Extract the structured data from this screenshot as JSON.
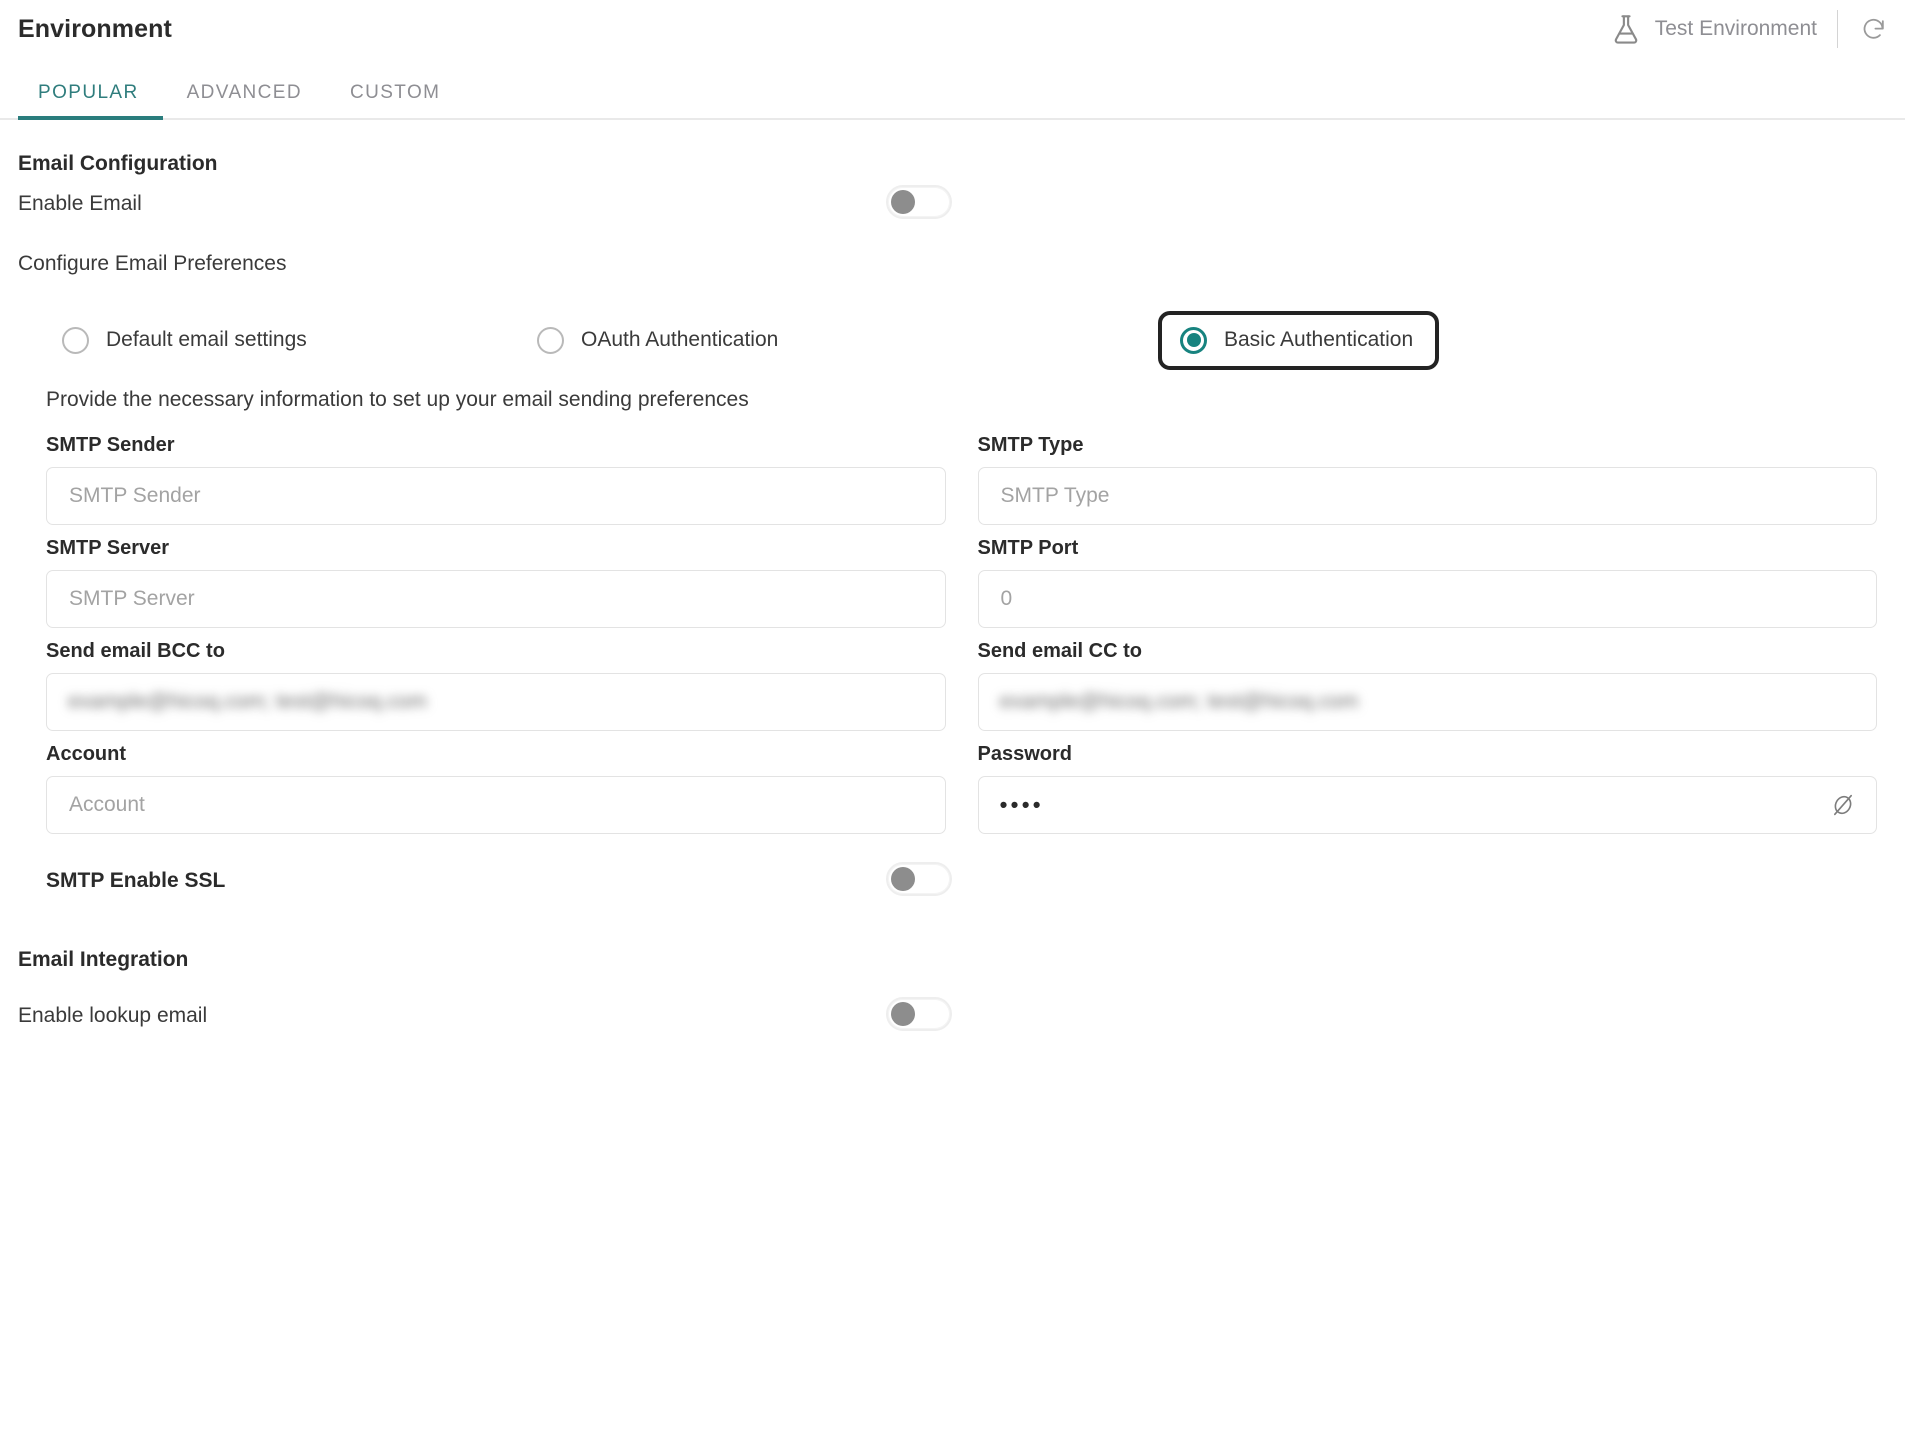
{
  "header": {
    "title": "Environment",
    "environment_label": "Test Environment",
    "flask_icon": "flask-icon",
    "refresh_icon": "refresh-icon"
  },
  "tabs": [
    {
      "label": "POPULAR",
      "active": true
    },
    {
      "label": "ADVANCED",
      "active": false
    },
    {
      "label": "CUSTOM",
      "active": false
    }
  ],
  "email_configuration": {
    "section_title": "Email Configuration",
    "enable_email": {
      "label": "Enable Email",
      "value": "off"
    },
    "configure_preferences_label": "Configure Email Preferences",
    "radio_options": [
      {
        "label": "Default email settings",
        "selected": false,
        "focused": false
      },
      {
        "label": "OAuth Authentication",
        "selected": false,
        "focused": false
      },
      {
        "label": "Basic Authentication",
        "selected": true,
        "focused": true
      }
    ],
    "helper_text": "Provide the necessary information to set up your email sending preferences",
    "fields": {
      "smtp_sender": {
        "label": "SMTP Sender",
        "value": "",
        "placeholder": "SMTP Sender"
      },
      "smtp_type": {
        "label": "SMTP Type",
        "value": "",
        "placeholder": "SMTP Type"
      },
      "smtp_server": {
        "label": "SMTP Server",
        "value": "",
        "placeholder": "SMTP Server"
      },
      "smtp_port": {
        "label": "SMTP Port",
        "value": "",
        "placeholder": "0"
      },
      "send_email_bcc_to": {
        "label": "Send email BCC to",
        "value": "example@hicoq.com; test@hicoq.com",
        "placeholder": ""
      },
      "send_email_cc_to": {
        "label": "Send email CC to",
        "value": "example@hicoq.com; test@hicoq.com",
        "placeholder": ""
      },
      "account": {
        "label": "Account",
        "value": "",
        "placeholder": "Account"
      },
      "password": {
        "label": "Password",
        "value": "••••",
        "placeholder": "",
        "reveal_icon": "eye-off-icon"
      }
    },
    "smtp_enable_ssl": {
      "label": "SMTP Enable SSL",
      "value": "off"
    }
  },
  "email_integration": {
    "section_title": "Email Integration",
    "enable_lookup_email": {
      "label": "Enable lookup email",
      "value": "off"
    }
  },
  "colors": {
    "accent_teal": "#2a7d7d",
    "radio_teal": "#17837f",
    "focus_outline": "#232323",
    "text_primary": "#2b2b2b",
    "text_secondary": "#8e8e93",
    "border": "#e3e3e3"
  }
}
